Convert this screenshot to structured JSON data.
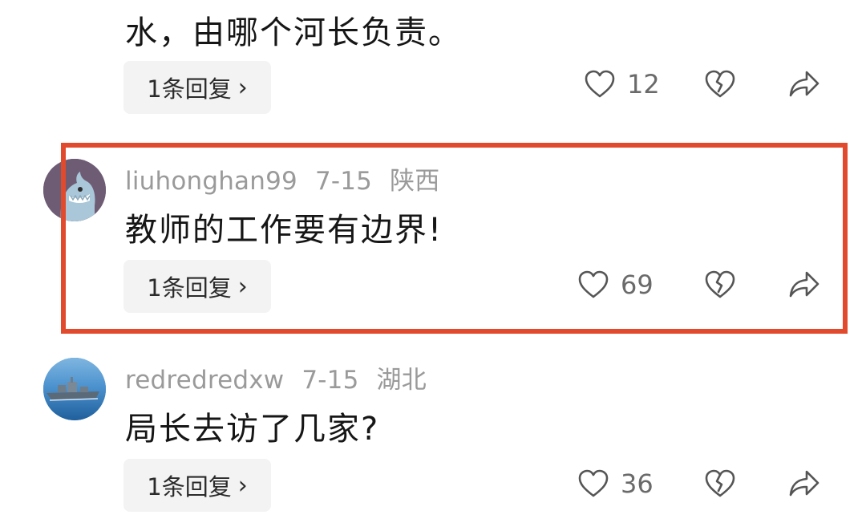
{
  "comments": [
    {
      "username": "",
      "date": "",
      "region": "",
      "text": "水，由哪个河长负责。",
      "reply_label": "1条回复",
      "like_count": "12"
    },
    {
      "username": "liuhonghan99",
      "date": "7-15",
      "region": "陕西",
      "text": "教师的工作要有边界!",
      "reply_label": "1条回复",
      "like_count": "69"
    },
    {
      "username": "redredredxw",
      "date": "7-15",
      "region": "湖北",
      "text": "局长去访了几家?",
      "reply_label": "1条回复",
      "like_count": "36"
    }
  ],
  "colors": {
    "highlight": "#e24a2e",
    "meta_text": "#9a9a9a",
    "reply_bg": "#f3f3f3"
  },
  "icons": {
    "like": "heart-outline-icon",
    "dislike": "broken-heart-icon",
    "share": "share-arrow-icon",
    "reply_chevron": "chevron-right-icon"
  }
}
